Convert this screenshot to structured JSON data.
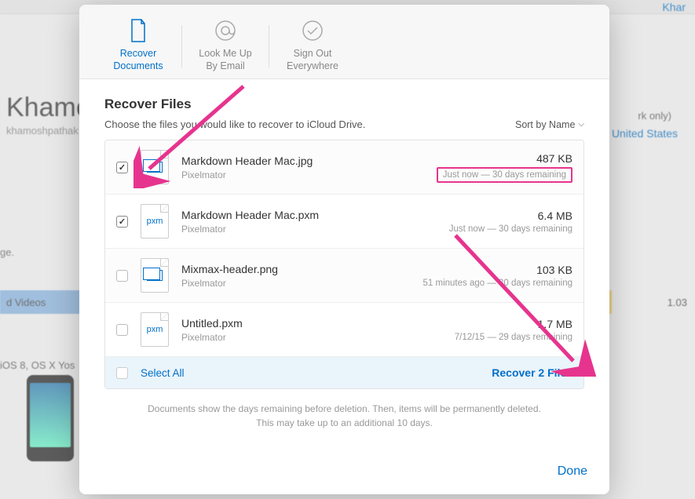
{
  "background": {
    "username_partial": "Khar",
    "title_partial": "Khamos",
    "email_partial": "khamoshpathak",
    "work_label": "rk only)",
    "country": "United States",
    "ge_text": "ge.",
    "videos_label": "d Videos",
    "storage_number": "1.03",
    "os_text": "iOS 8, OS X Yos"
  },
  "tabs": [
    {
      "line1": "Recover",
      "line2": "Documents",
      "active": true
    },
    {
      "line1": "Look Me Up",
      "line2": "By Email",
      "active": false
    },
    {
      "line1": "Sign Out",
      "line2": "Everywhere",
      "active": false
    }
  ],
  "heading": "Recover Files",
  "subtitle": "Choose the files you would like to recover to iCloud Drive.",
  "sort_label": "Sort by Name",
  "files": [
    {
      "name": "Markdown Header Mac.jpg",
      "app": "Pixelmator",
      "size": "487 KB",
      "time": "Just now — 30 days remaining",
      "checked": true,
      "icon": "image",
      "highlight": true
    },
    {
      "name": "Markdown Header Mac.pxm",
      "app": "Pixelmator",
      "size": "6.4 MB",
      "time": "Just now — 30 days remaining",
      "checked": true,
      "icon": "pxm",
      "highlight": false
    },
    {
      "name": "Mixmax-header.png",
      "app": "Pixelmator",
      "size": "103 KB",
      "time": "51 minutes ago — 30 days remaining",
      "checked": false,
      "icon": "image",
      "highlight": false
    },
    {
      "name": "Untitled.pxm",
      "app": "Pixelmator",
      "size": "1.7 MB",
      "time": "7/12/15 — 29 days remaining",
      "checked": false,
      "icon": "pxm",
      "highlight": false
    }
  ],
  "select_all_label": "Select All",
  "recover_label": "Recover 2 Files",
  "note_line1": "Documents show the days remaining before deletion. Then, items will be permanently deleted.",
  "note_line2": "This may take up to an additional 10 days.",
  "done_label": "Done",
  "icon_ext": "pxm"
}
